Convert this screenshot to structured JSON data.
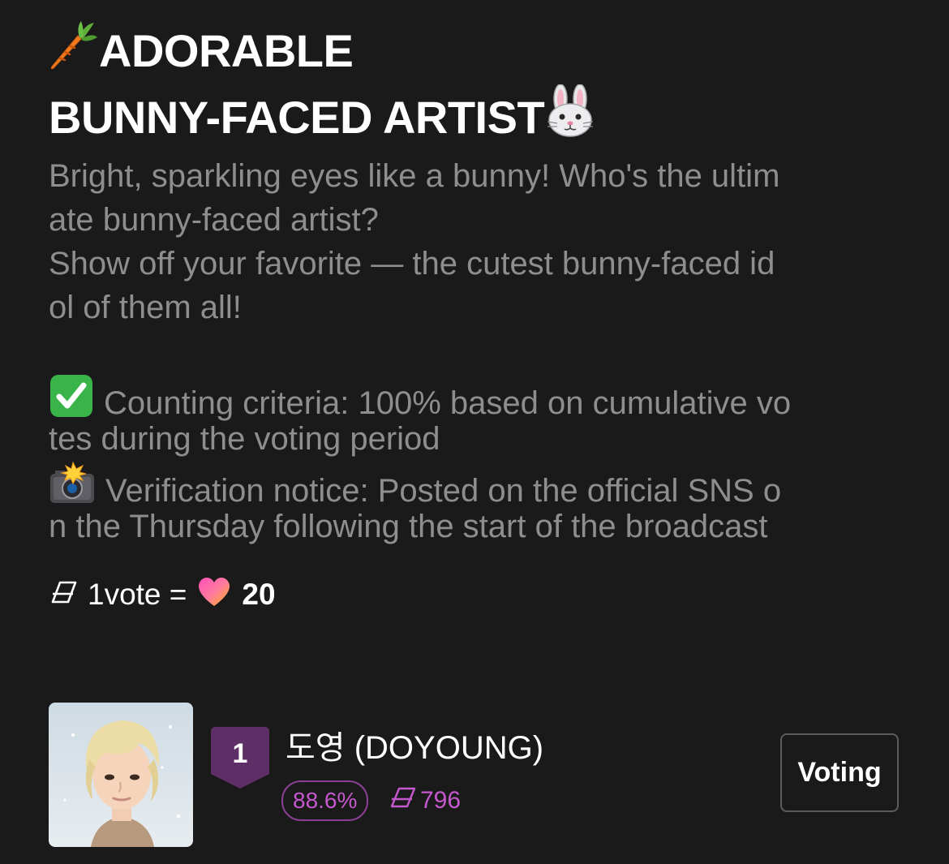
{
  "header": {
    "title_line1": "ADORABLE",
    "title_line2": "BUNNY-FACED ARTIST",
    "title_icon_left": "carrot-emoji",
    "title_icon_right": "rabbit-face-emoji"
  },
  "description": {
    "line1": "Bright, sparkling eyes like a bunny! Who's the ultim",
    "line2": "ate bunny-faced artist?",
    "line3": "Show off your favorite — the cutest bunny-faced id",
    "line4": "ol of them all!",
    "line5": "Counting criteria: 100% based on cumulative vo",
    "line6": "tes during the voting period",
    "line7": "Verification notice: Posted on the official SNS o",
    "line8": "n the Thursday following the start of the broadcast",
    "line5_icon": "check-mark-button-emoji",
    "line7_icon": "camera-with-flash-emoji"
  },
  "vote_rate": {
    "label": "1vote =",
    "amount": "20",
    "ticket_icon": "ticket-icon",
    "heart_icon": "gradient-heart-icon"
  },
  "candidates": [
    {
      "rank": "1",
      "name": "도영 (DOYOUNG)",
      "percent": "88.6%",
      "votes": "796",
      "button_label": "Voting"
    }
  ],
  "colors": {
    "background": "#1a1a1b",
    "muted_text": "#8e8e90",
    "accent_purple": "#c458cc",
    "rank_badge": "#5e2f66",
    "pill_border": "#8a3f92"
  }
}
